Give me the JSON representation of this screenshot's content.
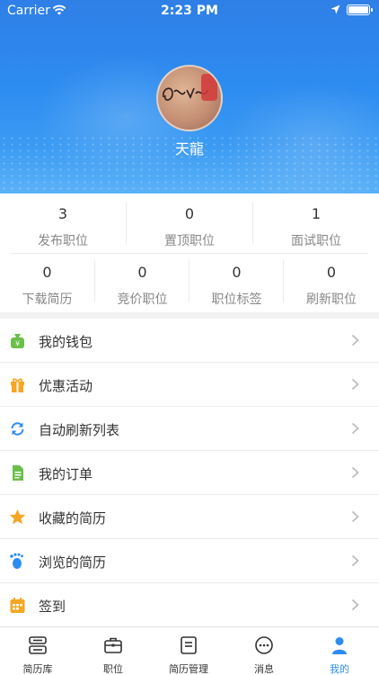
{
  "status_bar": {
    "carrier": "Carrier",
    "time": "2:23 PM"
  },
  "profile": {
    "username": "天龍"
  },
  "stats": [
    {
      "value": "3",
      "label": "发布职位"
    },
    {
      "value": "0",
      "label": "置顶职位"
    },
    {
      "value": "1",
      "label": "面试职位"
    },
    {
      "value": "0",
      "label": "下载简历"
    },
    {
      "value": "0",
      "label": "竞价职位"
    },
    {
      "value": "0",
      "label": "职位标签"
    },
    {
      "value": "0",
      "label": "刷新职位"
    }
  ],
  "menu": [
    {
      "label": "我的钱包",
      "icon": "wallet-icon"
    },
    {
      "label": "优惠活动",
      "icon": "gift-icon"
    },
    {
      "label": "自动刷新列表",
      "icon": "refresh-icon"
    },
    {
      "label": "我的订单",
      "icon": "order-icon"
    },
    {
      "label": "收藏的简历",
      "icon": "star-icon"
    },
    {
      "label": "浏览的简历",
      "icon": "footprint-icon"
    },
    {
      "label": "签到",
      "icon": "calendar-icon"
    }
  ],
  "tabbar": [
    {
      "label": "简历库",
      "icon": "resume-library-icon",
      "active": false
    },
    {
      "label": "职位",
      "icon": "briefcase-icon",
      "active": false
    },
    {
      "label": "简历管理",
      "icon": "document-icon",
      "active": false
    },
    {
      "label": "消息",
      "icon": "chat-icon",
      "active": false
    },
    {
      "label": "我的",
      "icon": "person-icon",
      "active": true
    }
  ],
  "colors": {
    "accent": "#2d8cf0",
    "wallet": "#6bbf4a",
    "gift": "#f5a623",
    "refresh": "#2d8cf0",
    "order": "#6bbf4a",
    "star": "#f5a623",
    "footprint": "#2d8cf0",
    "calendar": "#f5a623"
  }
}
